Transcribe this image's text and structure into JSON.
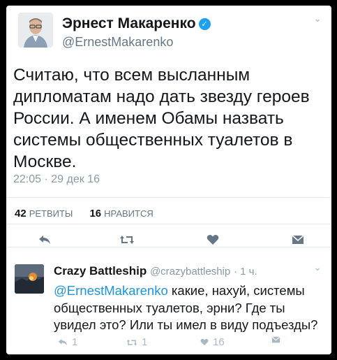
{
  "main_tweet": {
    "author_name": "Эрнест Макаренко",
    "verified_icon": "verified-check-icon",
    "handle": "@ErnestMakarenko",
    "text": "Считаю, что всем высланным дипломатам надо дать звезду героев России. А именем Обамы назвать системы общественных туалетов в Москве.",
    "timestamp": "22:05 · 29 дек 16",
    "retweets_count": "42",
    "retweets_label": "РЕТВИТЫ",
    "likes_count": "16",
    "likes_label": "НРАВИТСЯ",
    "actions": {
      "reply_icon": "reply-arrow-icon",
      "retweet_icon": "retweet-icon",
      "like_icon": "heart-icon",
      "dm_icon": "envelope-icon"
    }
  },
  "reply_tweet": {
    "author_name": "Crazy Battleship",
    "handle": "@crazybattleship",
    "time_ago": "· 1 ч.",
    "mention": "@ErnestMakarenko",
    "text": " какие, нахуй, системы общественных туалетов, эрни? Где ты увидел это? Или ты имел в виду подъезды?",
    "reply_count": "1",
    "retweet_count": "1",
    "like_count": "16",
    "actions": {
      "reply_icon": "reply-arrow-icon",
      "retweet_icon": "retweet-icon",
      "like_icon": "heart-icon",
      "dm_icon": "envelope-icon"
    }
  },
  "colors": {
    "link": "#1b95e0",
    "verified": "#1da1f2",
    "action_icons": "#657786",
    "muted_text": "#8899a6"
  }
}
